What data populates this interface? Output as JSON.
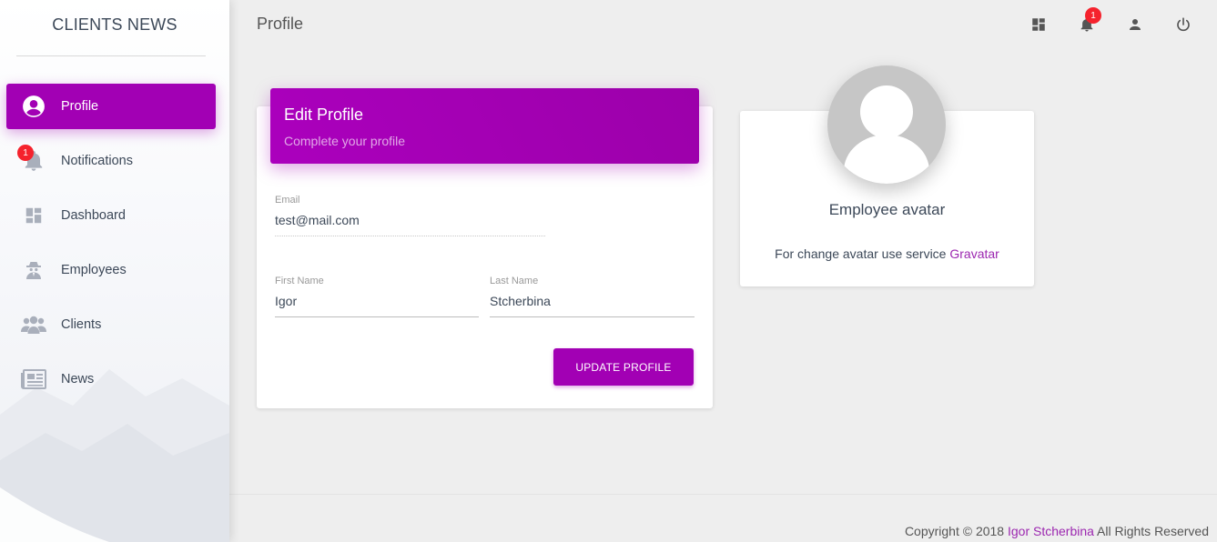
{
  "sidebar": {
    "brand": "CLIENTS NEWS",
    "items": [
      {
        "label": "Profile",
        "icon": "account-circle-icon",
        "active": true
      },
      {
        "label": "Notifications",
        "icon": "bell-icon",
        "badge": "1"
      },
      {
        "label": "Dashboard",
        "icon": "dashboard-icon"
      },
      {
        "label": "Employees",
        "icon": "spy-icon"
      },
      {
        "label": "Clients",
        "icon": "users-icon"
      },
      {
        "label": "News",
        "icon": "newspaper-icon"
      }
    ]
  },
  "header": {
    "title": "Profile",
    "notifications_badge": "1",
    "icons": [
      "dashboard-icon",
      "bell-icon",
      "person-icon",
      "power-icon"
    ]
  },
  "edit_profile": {
    "title": "Edit Profile",
    "subtitle": "Complete your profile",
    "email_label": "Email",
    "email_value": "test@mail.com",
    "first_name_label": "First Name",
    "first_name_value": "Igor",
    "last_name_label": "Last Name",
    "last_name_value": "Stcherbina",
    "update_button": "UPDATE PROFILE"
  },
  "avatar": {
    "title": "Employee avatar",
    "note_text": "For change avatar use service ",
    "link_text": "Gravatar"
  },
  "footer": {
    "prefix": "Copyright © 2018 ",
    "author": "Igor Stcherbina",
    "suffix": " All Rights Reserved"
  },
  "colors": {
    "accent": "#a200b4",
    "link": "#9c27b0",
    "badge": "#f5222d"
  }
}
